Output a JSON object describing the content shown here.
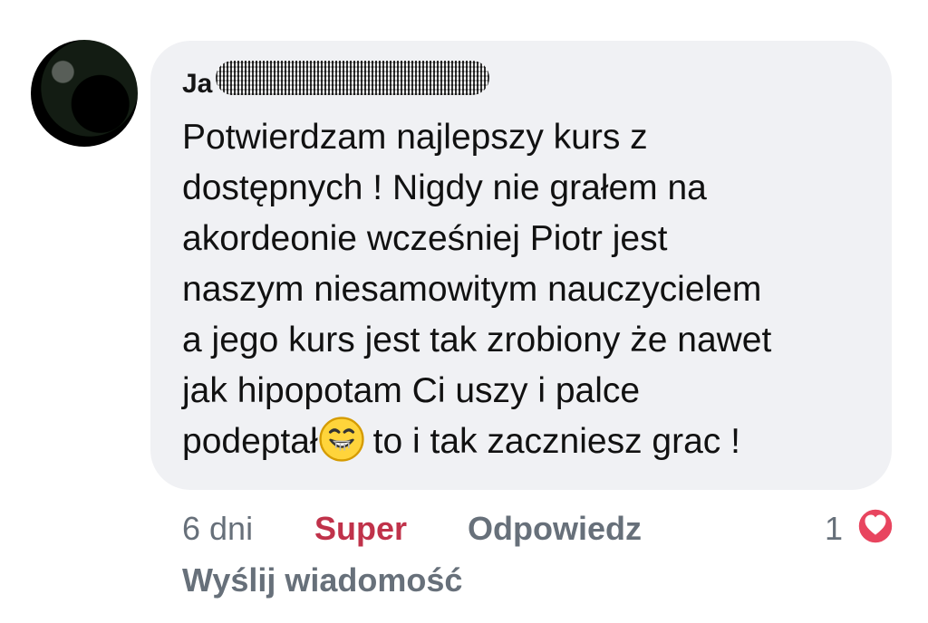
{
  "comment": {
    "author": "Ja",
    "lines": [
      "Potwierdzam najlepszy kurs z",
      "dostępnych ! Nigdy nie grałem na",
      "akordeonie wcześniej Piotr jest",
      "naszym niesamowitym nauczycielem",
      "a jego kurs jest tak zrobiony że nawet",
      "jak hipopotam Ci uszy i palce",
      "podeptał"
    ],
    "line_7_after_emoji": "to i tak zaczniesz grac !",
    "emoji": "grinning-face-emoji"
  },
  "actions": {
    "time": "6 dni",
    "reaction_label": "Super",
    "reply_label": "Odpowiedz",
    "reaction_count": "1",
    "send_message_label": "Wyślij wiadomość"
  },
  "colors": {
    "bubble_bg": "#f0f1f4",
    "meta_text": "#67707a",
    "super_red": "#c0324a",
    "heart_red": "#e8455f"
  },
  "icons": {
    "avatar": "avatar",
    "reaction": "heart-icon",
    "emoji": "grinning-face-emoji"
  }
}
